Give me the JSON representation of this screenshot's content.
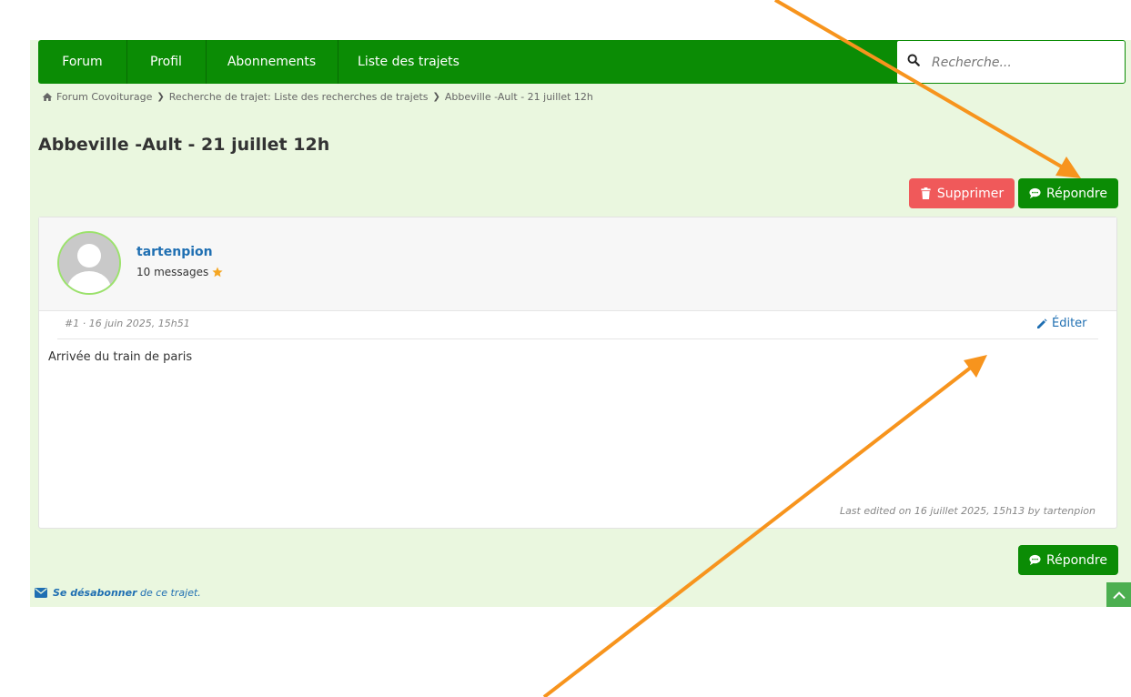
{
  "nav": {
    "items": [
      {
        "label": "Forum"
      },
      {
        "label": "Profil"
      },
      {
        "label": "Abonnements"
      },
      {
        "label": "Liste des trajets"
      }
    ],
    "search_placeholder": "Recherche..."
  },
  "breadcrumb": {
    "items": [
      {
        "label": "Forum Covoiturage"
      },
      {
        "label": "Recherche de trajet: Liste des recherches de trajets"
      },
      {
        "label": "Abbeville -Ault - 21 juillet 12h"
      }
    ]
  },
  "topic": {
    "title": "Abbeville -Ault - 21 juillet 12h"
  },
  "actions": {
    "delete_label": "Supprimer",
    "reply_label": "Répondre"
  },
  "post": {
    "author": "tartenpion",
    "message_count": "10 messages",
    "meta": "#1 · 16 juin 2025, 15h51",
    "edit_label": "Éditer",
    "body": "Arrivée du train de paris",
    "last_edited": "Last edited on 16 juillet 2025, 15h13 by tartenpion"
  },
  "footer": {
    "unsubscribe_bold": "Se désabonner",
    "unsubscribe_rest": "de ce trajet."
  },
  "colors": {
    "nav_green": "#0b8c05",
    "page_bg": "#eaf7df",
    "delete_red": "#f0595a",
    "link_blue": "#1f6fb2",
    "arrow_orange": "#f7941d"
  },
  "icons": [
    "home-icon",
    "chevron-right-icon",
    "search-icon",
    "trash-icon",
    "comment-icon",
    "pencil-icon",
    "star-icon",
    "envelope-icon",
    "chevron-up-icon"
  ]
}
